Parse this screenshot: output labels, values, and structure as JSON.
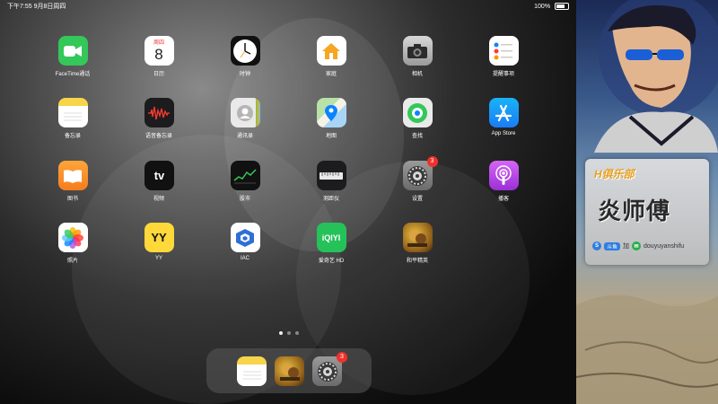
{
  "status_bar": {
    "time_date": "下午7:55  9月8日周四",
    "battery": "100%"
  },
  "apps": [
    {
      "label": "FaceTime通话",
      "icon": "facetime-icon"
    },
    {
      "label": "日历",
      "icon": "calendar-icon",
      "calendar_weekday": "周四",
      "calendar_day": "8"
    },
    {
      "label": "时钟",
      "icon": "clock-icon"
    },
    {
      "label": "家庭",
      "icon": "home-app-icon"
    },
    {
      "label": "相机",
      "icon": "camera-icon"
    },
    {
      "label": "提醒事项",
      "icon": "reminders-icon"
    },
    {
      "label": "备忘录",
      "icon": "notes-icon"
    },
    {
      "label": "语音备忘录",
      "icon": "voice-memos-icon"
    },
    {
      "label": "通讯录",
      "icon": "contacts-icon"
    },
    {
      "label": "地图",
      "icon": "maps-icon"
    },
    {
      "label": "查找",
      "icon": "find-my-icon"
    },
    {
      "label": "App Store",
      "icon": "app-store-icon"
    },
    {
      "label": "图书",
      "icon": "books-icon"
    },
    {
      "label": "视频",
      "icon": "apple-tv-icon",
      "icon_text": "tv"
    },
    {
      "label": "股市",
      "icon": "stocks-icon"
    },
    {
      "label": "测距仪",
      "icon": "measure-icon"
    },
    {
      "label": "设置",
      "icon": "settings-icon",
      "badge": "3"
    },
    {
      "label": "播客",
      "icon": "podcasts-icon"
    },
    {
      "label": "照片",
      "icon": "photos-icon"
    },
    {
      "label": "YY",
      "icon": "yy-icon",
      "icon_text": "YY"
    },
    {
      "label": "IAC",
      "icon": "iac-icon"
    },
    {
      "label": "爱奇艺 HD",
      "icon": "iqiyi-icon",
      "icon_text": "iQIYI"
    },
    {
      "label": "和平精英",
      "icon": "peacekeeper-elite-icon"
    }
  ],
  "page_dots": {
    "count": 3,
    "active_index": 0
  },
  "dock": [
    {
      "icon": "notes-icon"
    },
    {
      "icon": "peacekeeper-elite-icon"
    },
    {
      "icon": "settings-icon",
      "badge": "3"
    }
  ],
  "side_panel": {
    "club_label": "H俱乐部",
    "brand_name": "炎师傅",
    "social_tag": "斗鱼",
    "social_text": "douyuyanshifu",
    "connector": "加"
  },
  "colors": {
    "badge": "#f0312b",
    "accent_orange": "#e8a020"
  }
}
